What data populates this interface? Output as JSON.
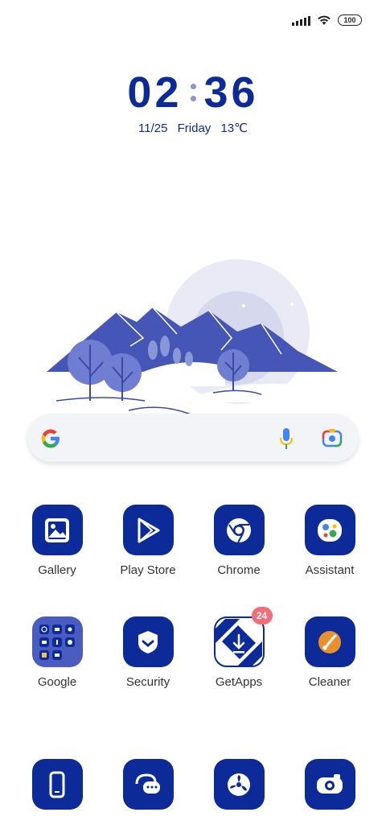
{
  "status_bar": {
    "battery": "100"
  },
  "clock": {
    "hours": "02",
    "minutes": "36"
  },
  "date": {
    "date": "11/25",
    "day": "Friday",
    "temp": "13℃"
  },
  "apps_row1": [
    {
      "label": "Gallery"
    },
    {
      "label": "Play Store"
    },
    {
      "label": "Chrome"
    },
    {
      "label": "Assistant"
    }
  ],
  "apps_row2": [
    {
      "label": "Google"
    },
    {
      "label": "Security"
    },
    {
      "label": "GetApps",
      "badge": "24"
    },
    {
      "label": "Cleaner"
    }
  ],
  "colors": {
    "accent": "#0d2a99",
    "badge": "#f36d7a",
    "moon": "#f2c14e"
  }
}
